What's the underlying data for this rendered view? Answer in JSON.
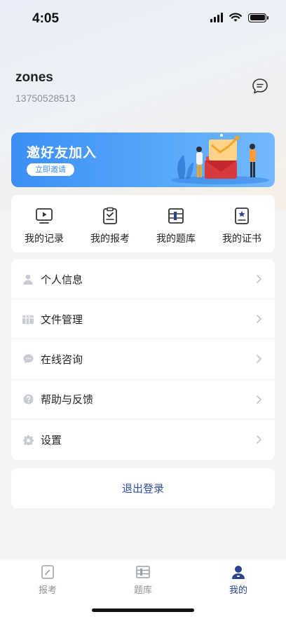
{
  "status_bar": {
    "time": "4:05"
  },
  "profile": {
    "username": "zones",
    "phone": "13750528513"
  },
  "banner": {
    "title": "邀好友加入",
    "button_label": "立即邀请"
  },
  "quick_actions": [
    {
      "label": "我的记录",
      "icon": "video-record-icon"
    },
    {
      "label": "我的报考",
      "icon": "clipboard-check-icon"
    },
    {
      "label": "我的题库",
      "icon": "question-bank-icon"
    },
    {
      "label": "我的证书",
      "icon": "certificate-icon"
    }
  ],
  "menu": [
    {
      "label": "个人信息",
      "icon": "person-icon"
    },
    {
      "label": "文件管理",
      "icon": "folder-icon"
    },
    {
      "label": "在线咨询",
      "icon": "chat-bubble-icon"
    },
    {
      "label": "帮助与反馈",
      "icon": "help-icon"
    },
    {
      "label": "设置",
      "icon": "gear-icon"
    }
  ],
  "logout_label": "退出登录",
  "tabs": [
    {
      "label": "报考",
      "icon": "exam-icon",
      "active": false
    },
    {
      "label": "题库",
      "icon": "question-bank-icon",
      "active": false
    },
    {
      "label": "我的",
      "icon": "user-icon",
      "active": true
    }
  ],
  "colors": {
    "accent": "#2a4490",
    "banner": "#3b8ef4",
    "background": "#f3f4f6"
  }
}
